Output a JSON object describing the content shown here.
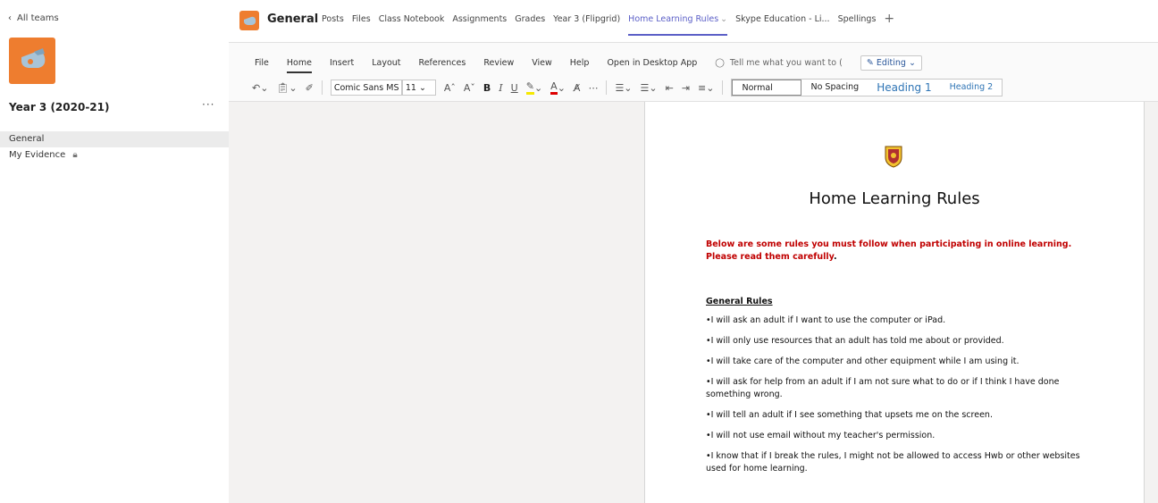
{
  "sidebar": {
    "back_label": "All teams",
    "team_name": "Year 3 (2020-21)",
    "more_label": "···",
    "channels": [
      {
        "label": "General"
      },
      {
        "label": "My Evidence"
      }
    ]
  },
  "header": {
    "channel_name": "General",
    "tabs": [
      {
        "label": "Posts"
      },
      {
        "label": "Files"
      },
      {
        "label": "Class Notebook"
      },
      {
        "label": "Assignments"
      },
      {
        "label": "Grades"
      },
      {
        "label": "Year 3 (Flipgrid)"
      },
      {
        "label": "Home Learning Rules"
      },
      {
        "label": "Skype Education - Li..."
      },
      {
        "label": "Spellings"
      }
    ],
    "add_tab_label": "+"
  },
  "ribbon": {
    "menu": {
      "file": "File",
      "home": "Home",
      "insert": "Insert",
      "layout": "Layout",
      "references": "References",
      "review": "Review",
      "view": "View",
      "help": "Help",
      "open_desktop": "Open in Desktop App",
      "tell_me": "Tell me what you want to (",
      "editing": "Editing"
    },
    "font_name": "Comic Sans MS",
    "font_size": "11",
    "styles": {
      "normal": "Normal",
      "no_spacing": "No Spacing",
      "heading1": "Heading 1",
      "heading2": "Heading 2"
    }
  },
  "document": {
    "title": "Home Learning Rules",
    "intro_main": "Below are some rules you must follow when participating in online learning. Please read them carefully",
    "intro_end": ".",
    "rules_heading": "General Rules",
    "rules": [
      "I will ask an adult if I want to use the computer or iPad.",
      "I will only use resources that an adult has told me about or provided.",
      "I will take care of the computer and other equipment while I am using it.",
      "I will ask for help from an adult if I am not sure what to do or if I think I have done something wrong.",
      "I will tell an adult if I see something that upsets me on the screen.",
      "I will not use email without my teacher's permission.",
      "I know that if I break the rules, I might not be allowed to access Hwb or other websites used for home learning."
    ]
  },
  "colors": {
    "accent": "#5b5fc7",
    "team_icon": "#ee7d2f",
    "intro_text": "#c00000",
    "heading_style": "#2e74b5"
  }
}
